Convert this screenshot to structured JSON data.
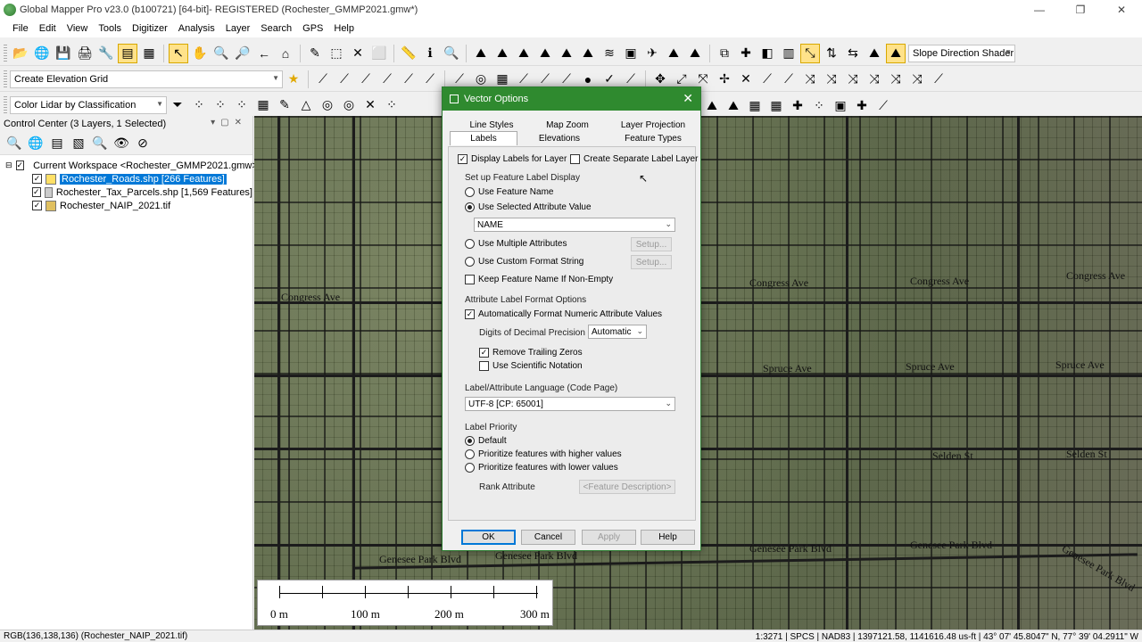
{
  "window": {
    "title": "Global Mapper Pro v23.0 (b100721) [64-bit]- REGISTERED (Rochester_GMMP2021.gmw*)",
    "controls": [
      "—",
      "❐",
      "✕"
    ]
  },
  "menu": [
    "File",
    "Edit",
    "View",
    "Tools",
    "Digitizer",
    "Analysis",
    "Layer",
    "Search",
    "GPS",
    "Help"
  ],
  "toolbars": {
    "shader": "Slope Direction Shader",
    "elevation_grid": "Create Elevation Grid",
    "lidar": "Color Lidar by Classification"
  },
  "control_center": {
    "title": "Control Center (3 Layers, 1 Selected)",
    "workspace": "Current Workspace <Rochester_GMMP2021.gmw>",
    "layers": [
      {
        "name": "Rochester_Roads.shp [266 Features]",
        "selected": true
      },
      {
        "name": "Rochester_Tax_Parcels.shp [1,569 Features]",
        "selected": false
      },
      {
        "name": "Rochester_NAIP_2021.tif",
        "selected": false
      }
    ]
  },
  "map": {
    "street_labels": [
      "Congress Ave",
      "Congress Ave",
      "Congress Ave",
      "Spruce Ave",
      "Spruce Ave",
      "Spruce Ave",
      "Selden St",
      "Selden St",
      "Genesee Park Blvd",
      "Genesee Park Blvd",
      "Genesee Park Blvd",
      "Genesee Park Blvd",
      "Congress Ave",
      "Genesee Park Blvd"
    ],
    "scale": {
      "labels": [
        "0 m",
        "100 m",
        "200 m",
        "300 m"
      ]
    }
  },
  "status": {
    "left": "RGB(136,138,136) (Rochester_NAIP_2021.tif)",
    "right": "1:3271 | SPCS | NAD83 | 1397121.58, 1141616.48 us-ft | 43° 07' 45.8047\" N, 77° 39' 04.2911\" W"
  },
  "dialog": {
    "title": "Vector Options",
    "close": "✕",
    "tabs": [
      {
        "label": "Line Styles"
      },
      {
        "label": "Map Zoom"
      },
      {
        "label": "Layer Projection"
      },
      {
        "label": "Labels"
      },
      {
        "label": "Elevations"
      },
      {
        "label": "Feature Types"
      }
    ],
    "display_labels": "Display Labels for Layer",
    "separate_layer": "Create Separate Label Layer",
    "setup_section": "Set up Feature Label Display",
    "use_feature_name": "Use Feature Name",
    "use_selected_attr": "Use Selected Attribute Value",
    "attr_value": "NAME",
    "use_multiple": "Use Multiple Attributes",
    "use_custom": "Use Custom Format String",
    "setup": "Setup...",
    "keep_name": "Keep Feature Name If Non-Empty",
    "format_section": "Attribute Label Format Options",
    "auto_format": "Automatically Format Numeric Attribute Values",
    "digits_label": "Digits of Decimal Precision",
    "digits_value": "Automatic",
    "remove_zeros": "Remove Trailing Zeros",
    "sci_notation": "Use Scientific Notation",
    "lang_section": "Label/Attribute Language (Code Page)",
    "lang_value": "UTF-8 [CP: 65001]",
    "priority_section": "Label Priority",
    "priority_default": "Default",
    "priority_higher": "Prioritize features with higher values",
    "priority_lower": "Prioritize features with lower values",
    "rank_label": "Rank Attribute",
    "rank_value": "<Feature Description>",
    "buttons": {
      "ok": "OK",
      "cancel": "Cancel",
      "apply": "Apply",
      "help": "Help"
    }
  }
}
